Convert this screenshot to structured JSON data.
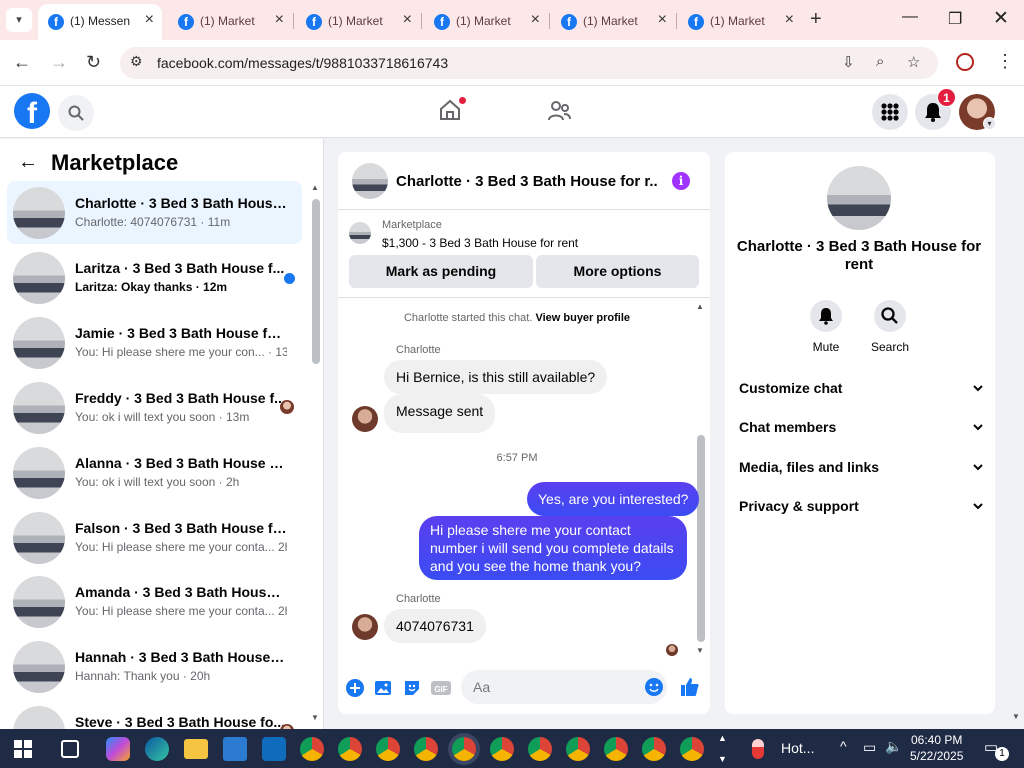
{
  "browser": {
    "tabs": [
      {
        "label": "(1) Messen",
        "active": true
      },
      {
        "label": "(1) Market",
        "active": false
      },
      {
        "label": "(1) Market",
        "active": false
      },
      {
        "label": "(1) Market",
        "active": false
      },
      {
        "label": "(1) Market",
        "active": false
      },
      {
        "label": "(1) Market",
        "active": false
      }
    ],
    "url": "facebook.com/messages/t/9881033718616743"
  },
  "header": {
    "notification_count": "1",
    "fb_logo": "f"
  },
  "marketplace": {
    "title": "Marketplace",
    "conversations": [
      {
        "name": "Charlotte · 3 Bed 3 Bath House f...",
        "preview": "Charlotte: 4074076731 · 11m",
        "status": "active"
      },
      {
        "name": "Laritza · 3 Bed 3 Bath House f...",
        "preview": "Laritza: Okay thanks · 12m",
        "status": "unread"
      },
      {
        "name": "Jamie · 3 Bed 3 Bath House for r...",
        "preview": "You: Hi please shere me your con... · 13m",
        "status": ""
      },
      {
        "name": "Freddy · 3 Bed 3 Bath House f...",
        "preview": "You: ok i will text you soon · 13m",
        "status": "seen"
      },
      {
        "name": "Alanna · 3 Bed 3 Bath House for...",
        "preview": "You: ok i will text you soon · 2h",
        "status": ""
      },
      {
        "name": "Falson · 3 Bed 3 Bath House for ...",
        "preview": "You: Hi please shere me your conta... 2h",
        "status": ""
      },
      {
        "name": "Amanda · 3 Bed 3 Bath House f...",
        "preview": "You: Hi please shere me your conta... 2h",
        "status": ""
      },
      {
        "name": "Hannah · 3 Bed 3 Bath House fo...",
        "preview": "Hannah: Thank you · 20h",
        "status": ""
      },
      {
        "name": "Steve · 3 Bed 3 Bath House fo...",
        "preview": "",
        "status": "seen"
      }
    ]
  },
  "chat": {
    "title": "Charlotte · 3 Bed 3 Bath House for r...",
    "info_icon": "i",
    "listing_label": "Marketplace",
    "listing_price": "$1,300 - 3 Bed 3 Bath House for rent",
    "mark_pending": "Mark as pending",
    "more_options": "More options",
    "started_text": "Charlotte started this chat.",
    "view_profile": "View buyer profile",
    "sender_1": "Charlotte",
    "msg_1": "Hi Bernice, is this still available?",
    "msg_2": "Message sent",
    "time": "6:57 PM",
    "msg_3": "Yes, are you interested?",
    "msg_4": "Hi please shere me your contact number i will send you complete datails and you see the home thank you?",
    "sender_2": "Charlotte",
    "msg_5": "4074076731",
    "input_placeholder": "Aa"
  },
  "info": {
    "title": "Charlotte · 3 Bed 3 Bath House for rent",
    "mute": "Mute",
    "search": "Search",
    "sections": [
      "Customize chat",
      "Chat members",
      "Media, files and links",
      "Privacy & support"
    ]
  },
  "taskbar": {
    "weather": "Hot...",
    "time": "06:40 PM",
    "date": "5/22/2025",
    "notif_count": "1"
  },
  "colors": {
    "fb_blue": "#1877f2",
    "messenger_purple": "#a033ff",
    "outgoing_bubble": "#4e44f2",
    "notification_red": "#e41e3f"
  }
}
